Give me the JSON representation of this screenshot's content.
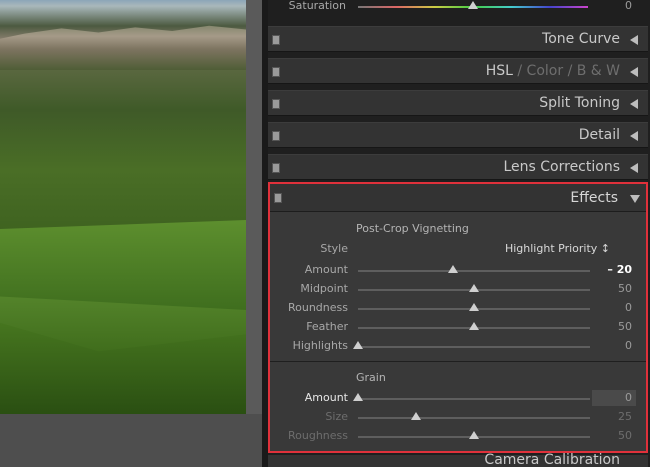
{
  "top_partial": {
    "saturation_label": "Saturation",
    "saturation_value": "0",
    "saturation_position": 0.5
  },
  "sections": {
    "tone_curve": "Tone Curve",
    "hsl": "HSL",
    "hsl_sep1": "/",
    "color": "Color",
    "hsl_sep2": "/",
    "bw": "B & W",
    "split_toning": "Split Toning",
    "detail": "Detail",
    "lens_corrections": "Lens Corrections"
  },
  "effects": {
    "title": "Effects",
    "vignette_heading": "Post-Crop Vignetting",
    "style_label": "Style",
    "style_value": "Highlight Priority ↕",
    "sliders": [
      {
        "label": "Amount",
        "value": "– 20",
        "position": 0.41
      },
      {
        "label": "Midpoint",
        "value": "50",
        "position": 0.5
      },
      {
        "label": "Roundness",
        "value": "0",
        "position": 0.5
      },
      {
        "label": "Feather",
        "value": "50",
        "position": 0.5
      },
      {
        "label": "Highlights",
        "value": "0",
        "position": 0.0
      }
    ],
    "grain_heading": "Grain",
    "grain_sliders": [
      {
        "label": "Amount",
        "value": "0",
        "position": 0.0
      },
      {
        "label": "Size",
        "value": "25",
        "position": 0.25
      },
      {
        "label": "Roughness",
        "value": "50",
        "position": 0.5
      }
    ]
  },
  "bottom_partial": "Camera Calibration"
}
